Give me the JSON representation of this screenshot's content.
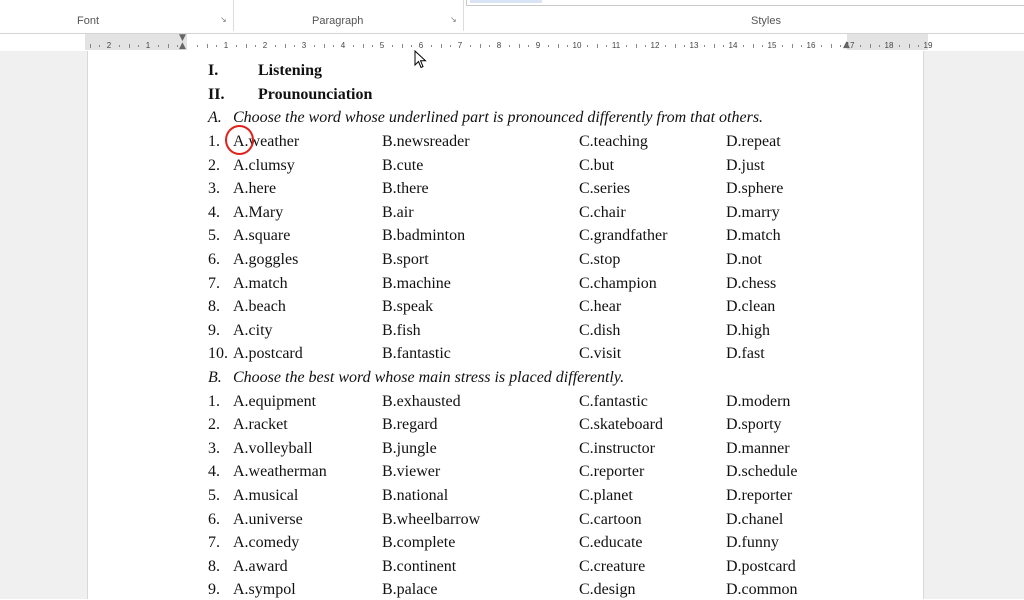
{
  "ribbon": {
    "groups": [
      {
        "label": "Font"
      },
      {
        "label": "Paragraph"
      },
      {
        "label": "Styles"
      }
    ]
  },
  "ruler": {
    "numbers": [
      "2",
      "1",
      "1",
      "2",
      "3",
      "4",
      "5",
      "6",
      "7",
      "8",
      "9",
      "10",
      "11",
      "12",
      "13",
      "14",
      "15",
      "16",
      "17",
      "18",
      "19"
    ]
  },
  "document": {
    "headings": [
      {
        "numeral": "I.",
        "text": "Listening"
      },
      {
        "numeral": "II.",
        "text": "Prounounciation"
      }
    ],
    "sectionA": {
      "letter": "A.",
      "instruction": "Choose the word whose underlined part is pronounced differently from that others.",
      "rows": [
        {
          "n": "1.",
          "a": "A.weather",
          "b": "B.newsreader",
          "c": "C.teaching",
          "d": "D.repeat"
        },
        {
          "n": "2.",
          "a": "A.clumsy",
          "b": "B.cute",
          "c": "C.but",
          "d": "D.just"
        },
        {
          "n": "3.",
          "a": "A.here",
          "b": "B.there",
          "c": "C.series",
          "d": "D.sphere"
        },
        {
          "n": "4.",
          "a": "A.Mary",
          "b": "B.air",
          "c": "C.chair",
          "d": "D.marry"
        },
        {
          "n": "5.",
          "a": "A.square",
          "b": "B.badminton",
          "c": "C.grandfather",
          "d": "D.match"
        },
        {
          "n": "6.",
          "a": "A.goggles",
          "b": "B.sport",
          "c": "C.stop",
          "d": "D.not"
        },
        {
          "n": "7.",
          "a": "A.match",
          "b": "B.machine",
          "c": "C.champion",
          "d": "D.chess"
        },
        {
          "n": "8.",
          "a": "A.beach",
          "b": "B.speak",
          "c": "C.hear",
          "d": "D.clean"
        },
        {
          "n": "9.",
          "a": "A.city",
          "b": "B.fish",
          "c": "C.dish",
          "d": "D.high"
        },
        {
          "n": "10.",
          "a": "A.postcard",
          "b": "B.fantastic",
          "c": "C.visit",
          "d": "D.fast"
        }
      ]
    },
    "sectionB": {
      "letter": "B.",
      "instruction": "Choose the best word whose main stress is placed differently.",
      "rows": [
        {
          "n": "1.",
          "a": "A.equipment",
          "b": "B.exhausted",
          "c": "C.fantastic",
          "d": "D.modern"
        },
        {
          "n": "2.",
          "a": "A.racket",
          "b": "B.regard",
          "c": "C.skateboard",
          "d": "D.sporty"
        },
        {
          "n": "3.",
          "a": "A.volleyball",
          "b": "B.jungle",
          "c": "C.instructor",
          "d": "D.manner"
        },
        {
          "n": "4.",
          "a": "A.weatherman",
          "b": "B.viewer",
          "c": "C.reporter",
          "d": "D.schedule"
        },
        {
          "n": "5.",
          "a": "A.musical",
          "b": "B.national",
          "c": "C.planet",
          "d": "D.reporter"
        },
        {
          "n": "6.",
          "a": "A.universe",
          "b": "B.wheelbarrow",
          "c": "C.cartoon",
          "d": "D.chanel"
        },
        {
          "n": "7.",
          "a": "A.comedy",
          "b": "B.complete",
          "c": "C.educate",
          "d": "D.funny"
        },
        {
          "n": "8.",
          "a": "A.award",
          "b": "B.continent",
          "c": "C.creature",
          "d": "D.postcard"
        },
        {
          "n": "9.",
          "a": "A.sympol",
          "b": "B.palace",
          "c": "C.design",
          "d": "D.common"
        }
      ]
    }
  }
}
